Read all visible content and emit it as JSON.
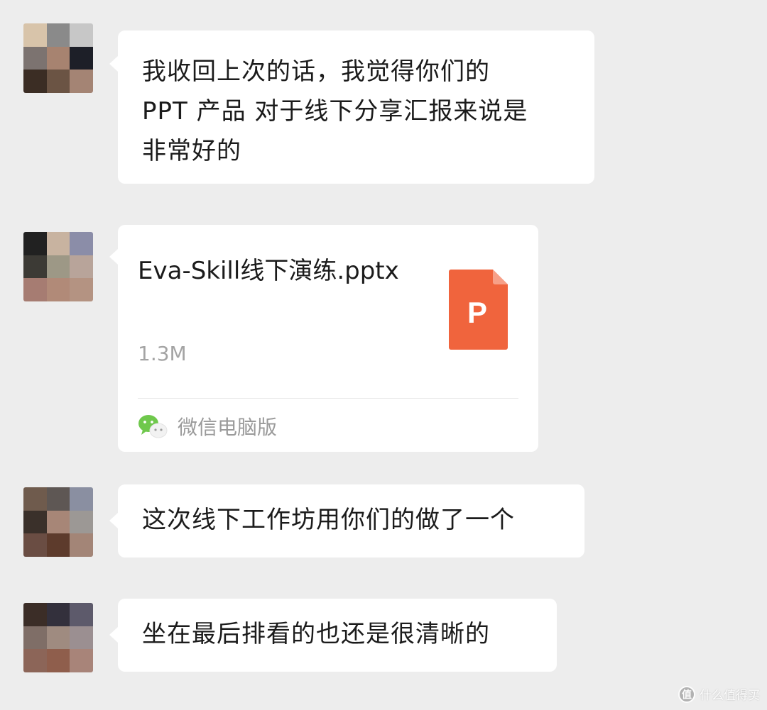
{
  "messages": [
    {
      "type": "text",
      "text": "我收回上次的话，我觉得你们的\nPPT 产品 对于线下分享汇报来说是\n非常好的",
      "avatar_colors": [
        "#d8c4aa",
        "#8a8a8a",
        "#c7c7c7",
        "#7c7370",
        "#a78370",
        "#1d1f28",
        "#3b2d24",
        "#6b5444",
        "#a48474"
      ]
    },
    {
      "type": "file",
      "file_name": "Eva-Skill线下演练.pptx",
      "file_size": "1.3M",
      "source_label": "微信电脑版",
      "file_icon": "pptx-file-icon",
      "file_icon_letter": "P",
      "file_icon_color": "#f0643d",
      "avatar_colors": [
        "#212121",
        "#c8b3a0",
        "#8b8da8",
        "#3c3a35",
        "#9d9886",
        "#b8a49a",
        "#a67c72",
        "#b18a78",
        "#b49382"
      ]
    },
    {
      "type": "text",
      "text": "这次线下工作坊用你们的做了一个",
      "avatar_colors": [
        "#6f5b4d",
        "#5e5754",
        "#8a8fa1",
        "#3a302a",
        "#a78677",
        "#9c9895",
        "#6a4d43",
        "#5d3b2c",
        "#a38577"
      ]
    },
    {
      "type": "text",
      "text": "坐在最后排看的也还是很清晰的",
      "avatar_colors": [
        "#3b2d27",
        "#33303c",
        "#5d5a6b",
        "#7f6e67",
        "#9f8b80",
        "#9b8f91",
        "#8c6558",
        "#8f5e4c",
        "#a88479"
      ]
    }
  ],
  "watermark": {
    "icon": "值",
    "text": "什么值得买"
  },
  "colors": {
    "background": "#ededed",
    "bubble": "#ffffff",
    "text": "#1b1b1b",
    "secondary_text": "#9a9a9a",
    "wechat_green": "#6fc84c"
  }
}
